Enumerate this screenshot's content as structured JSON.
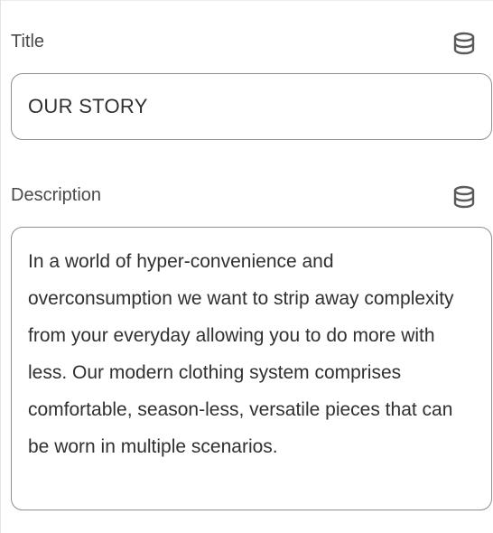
{
  "fields": {
    "title": {
      "label": "Title",
      "value": "OUR STORY",
      "icon": "database-icon"
    },
    "description": {
      "label": "Description",
      "value": "In a world of hyper-convenience and overconsumption we want to strip away complexity from your everyday allowing you to do more with less. Our modern clothing system comprises comfortable, season-less, versatile pieces that can be worn in multiple scenarios.",
      "icon": "database-icon"
    }
  },
  "colors": {
    "border": "#8f8f8f",
    "text": "#303030",
    "label": "#4a4a4a",
    "icon": "#5a5a5a"
  }
}
